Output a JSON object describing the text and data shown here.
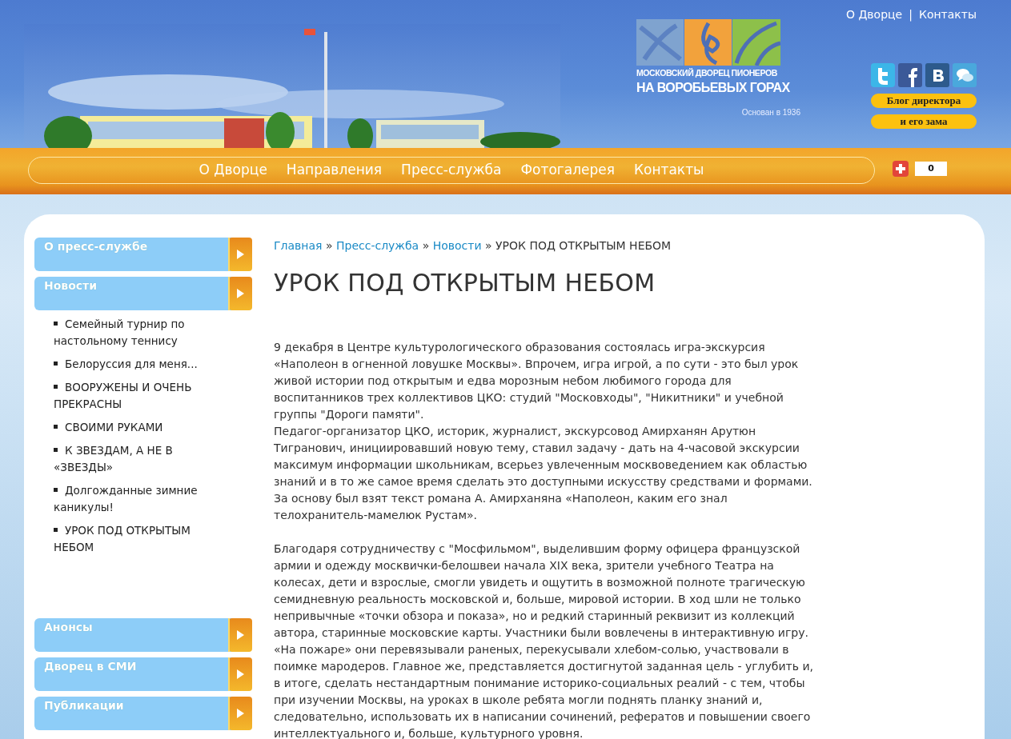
{
  "top_links": [
    {
      "label": "О Дворце",
      "separator": "|"
    },
    {
      "label": "Контакты"
    }
  ],
  "logo": {
    "line_1": "МОСКОВСКИЙ ДВОРЕЦ ПИОНЕРОВ",
    "line_2": "НА ВОРОБЬЕВЫХ ГОРАХ",
    "founded": "Основан в 1936"
  },
  "social": [
    {
      "kind": "twitter"
    },
    {
      "kind": "facebook"
    },
    {
      "kind": "vk"
    },
    {
      "kind": "chat"
    }
  ],
  "blog_buttons": [
    "Блог директора",
    "и его зама"
  ],
  "nav": [
    "О Дворце",
    "Направления",
    "Пресс-служба",
    "Фотогалерея",
    "Контакты"
  ],
  "share": {
    "count": "0"
  },
  "sidebar": [
    {
      "label": "О пресс-службе"
    },
    {
      "label": "Новости",
      "children": [
        {
          "label": "Семейный турнир по настольному теннису"
        },
        {
          "label": "Белоруссия для меня..."
        },
        {
          "label": "ВООРУЖЕНЫ И ОЧЕНЬ ПРЕКРАСНЫ"
        },
        {
          "label": "СВОИМИ РУКАМИ"
        },
        {
          "label": "К ЗВЕЗДАМ, А НЕ В «ЗВЕЗДЫ»"
        },
        {
          "label": "Долгожданные зимние каникулы!"
        },
        {
          "label": "УРОК ПОД ОТКРЫТЫМ НЕБОМ"
        }
      ]
    },
    {
      "label": "Анонсы"
    },
    {
      "label": "Дворец в СМИ"
    },
    {
      "label": "Публикации"
    }
  ],
  "breadcrumbs": [
    {
      "label": "Главная",
      "current": false,
      "separator": "»"
    },
    {
      "label": "Пресс-служба",
      "current": false,
      "separator": "»"
    },
    {
      "label": "Новости",
      "current": false,
      "separator": "»"
    },
    {
      "label": "УРОК ПОД ОТКРЫТЫМ НЕБОМ",
      "current": true
    }
  ],
  "title": "УРОК ПОД ОТКРЫТЫМ НЕБОМ",
  "article": [
    [
      "9 декабря в Центре культурологического образования состоялась игра-экскурсия «Наполеон в огненной ловушке Москвы». Впрочем, игра игрой, а по сути - это был урок живой истории под открытым и едва морозным небом любимого города для воспитанников трех коллективов ЦКО: студий \"Московходы\", \"Никитники\" и учебной группы \"Дороги памяти\".",
      "Педагог-организатор ЦКО, историк, журналист, экскурсовод Амирханян Арутюн Тигранович, инициировавший новую тему, ставил задачу - дать на 4-часовой экскурсии максимум информации школьникам, всерьез увлеченным москвоведением как областью знаний и в то же самое время сделать это доступными искусству средствами и формами. За основу был взят текст романа А. Амирханяна «Наполеон, каким его знал телохранитель-мамелюк Рустам»."
    ],
    [
      "Благодаря сотрудничеству с \"Мосфильмом\", выделившим форму офицера французской армии и одежду москвички-белошвеи начала XIX века, зрители учебного Театра на колесах, дети и взрослые, смогли увидеть и ощутить в возможной полноте трагическую семидневную реальность московской и, больше, мировой истории. В ход шли не только непривычные «точки обзора и показа», но и редкий старинный реквизит из коллекций автора, старинные московские карты. Участники были вовлечены в интерактивную игру. «На пожаре» они перевязывали раненых, перекусывали хлебом-солью, участвовали в поимке мародеров. Главное же, представляется достигнутой заданная цель - углубить и, в итоге, сделать нестандартным понимание историко-социальных реалий - с тем, чтобы при изучении Москвы, на уроках в школе ребята могли поднять планку знаний и, следовательно, использовать их в написании сочинений, рефератов и повышении своего интеллектуального и, больше, культурного уровня."
    ]
  ]
}
